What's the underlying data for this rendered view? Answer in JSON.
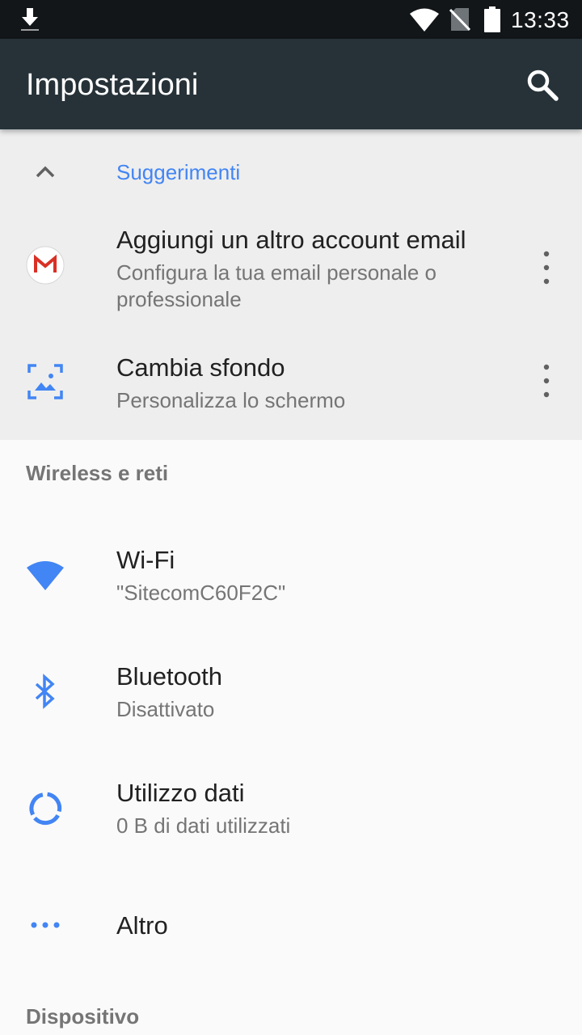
{
  "status_bar": {
    "time": "13:33",
    "icons": [
      "download-icon",
      "wifi-icon",
      "no-sim-icon",
      "battery-icon"
    ]
  },
  "app_bar": {
    "title": "Impostazioni",
    "search_icon": "search-icon"
  },
  "suggestions": {
    "header": "Suggerimenti",
    "items": [
      {
        "title": "Aggiungi un altro account email",
        "subtitle": "Configura la tua email personale o professionale",
        "icon": "gmail-icon"
      },
      {
        "title": "Cambia sfondo",
        "subtitle": "Personalizza lo schermo",
        "icon": "wallpaper-icon"
      }
    ]
  },
  "sections": [
    {
      "header": "Wireless e reti",
      "items": [
        {
          "title": "Wi-Fi",
          "subtitle": "\"SitecomC60F2C\"",
          "icon": "wifi-icon"
        },
        {
          "title": "Bluetooth",
          "subtitle": "Disattivato",
          "icon": "bluetooth-icon"
        },
        {
          "title": "Utilizzo dati",
          "subtitle": "0 B di dati utilizzati",
          "icon": "data-usage-icon"
        },
        {
          "title": "Altro",
          "icon": "more-horiz-icon"
        }
      ]
    },
    {
      "header": "Dispositivo",
      "items": []
    }
  ],
  "colors": {
    "status_bar": "#121619",
    "app_bar": "#263238",
    "accent": "#4285f4",
    "suggestions_bg": "#eeeeee",
    "page_bg": "#fafafa",
    "primary_text": "#212121",
    "secondary_text": "#757575"
  }
}
